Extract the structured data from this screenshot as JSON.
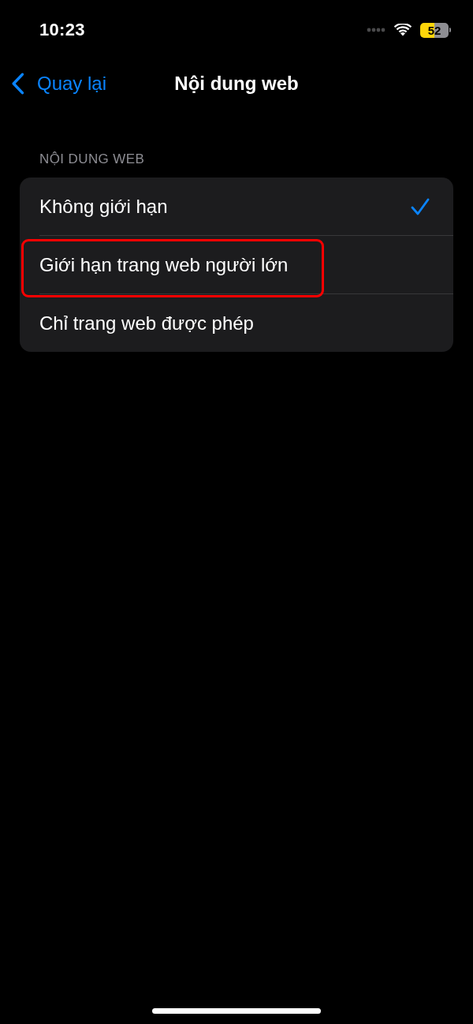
{
  "status_bar": {
    "time": "10:23",
    "battery": "52"
  },
  "nav_bar": {
    "back": {
      "label": "Quay lại"
    },
    "title": "Nội dung web"
  },
  "section": {
    "header": "NỘI DUNG WEB",
    "options": [
      {
        "label": "Không giới hạn",
        "selected": true,
        "highlighted": false
      },
      {
        "label": "Giới hạn trang web người lớn",
        "selected": false,
        "highlighted": true
      },
      {
        "label": "Chỉ trang web được phép",
        "selected": false,
        "highlighted": false
      }
    ]
  }
}
